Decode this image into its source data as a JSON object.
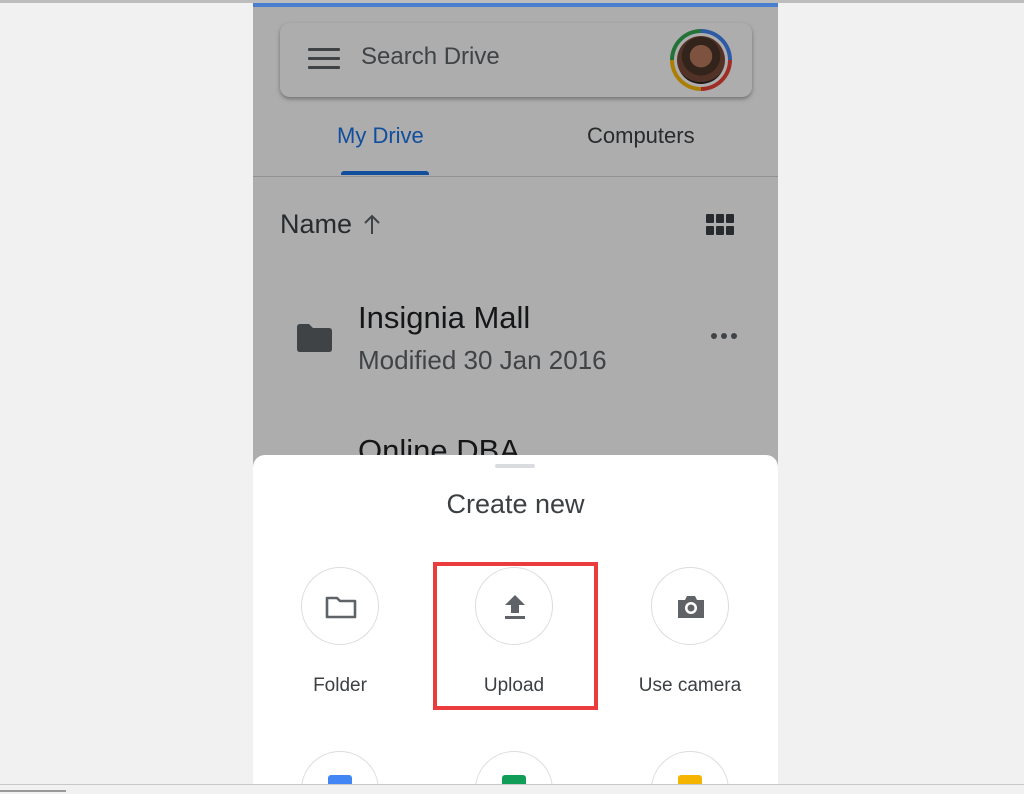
{
  "search": {
    "placeholder": "Search Drive"
  },
  "tabs": [
    {
      "label": "My Drive",
      "active": true
    },
    {
      "label": "Computers",
      "active": false
    }
  ],
  "sort": {
    "label": "Name",
    "direction_icon": "arrow-up-icon"
  },
  "view_toggle_icon": "grid-view-icon",
  "files": [
    {
      "name": "Insignia Mall",
      "meta": "Modified 30 Jan 2016",
      "icon": "folder-icon"
    },
    {
      "name": "Online DBA",
      "meta": "",
      "icon": ""
    }
  ],
  "sheet": {
    "title": "Create new",
    "actions": [
      {
        "label": "Folder",
        "icon": "folder-outline-icon"
      },
      {
        "label": "Upload",
        "icon": "upload-icon"
      },
      {
        "label": "Use camera",
        "icon": "camera-icon"
      }
    ],
    "second_row_icons": [
      "google-docs-icon",
      "google-sheets-icon",
      "google-slides-icon"
    ]
  },
  "colors": {
    "accent": "#1a73e8",
    "highlight": "#ea3c3c",
    "docs": "#4285f4",
    "sheets": "#0f9d58",
    "slides": "#f4b400"
  }
}
